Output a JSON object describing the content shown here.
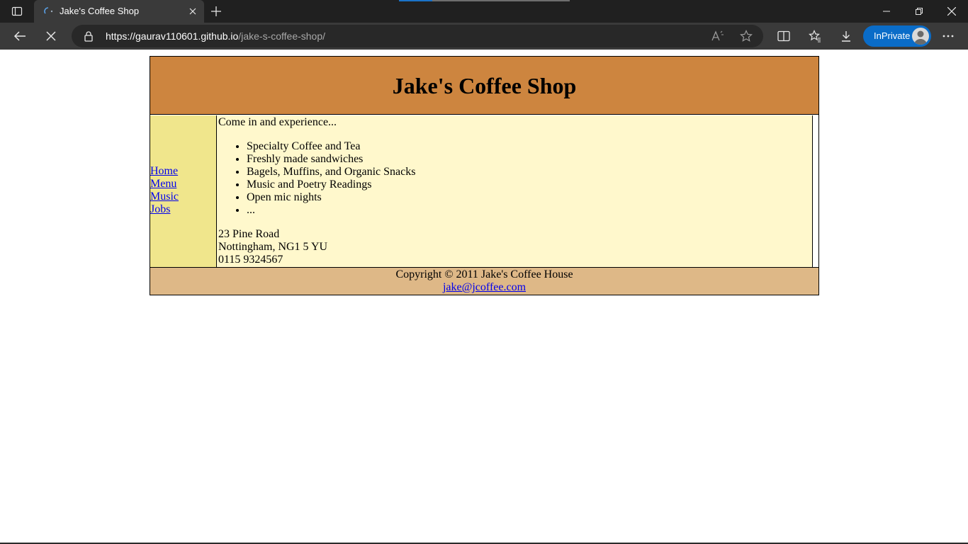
{
  "browser": {
    "tab": {
      "title": "Jake's Coffee Shop"
    },
    "address": {
      "host": "https://gaurav110601.github.io",
      "path": "/jake-s-coffee-shop/"
    },
    "profile_label": "InPrivate",
    "accent_color": "#0a6cc8",
    "icons": [
      "tab-actions-icon",
      "close-icon",
      "plus-icon",
      "minimize-icon",
      "restore-icon",
      "window-close-icon",
      "back-arrow-icon",
      "stop-icon",
      "lock-icon",
      "read-aloud-icon",
      "star-icon",
      "split-screen-icon",
      "favorites-icon",
      "download-icon",
      "avatar-icon",
      "more-icon"
    ]
  },
  "site": {
    "title": "Jake's Coffee Shop",
    "colors": {
      "header": "#cd853f",
      "nav": "#f0e68c",
      "main": "#fff8cc",
      "footer": "#deb887"
    },
    "nav": [
      "Home",
      "Menu",
      "Music",
      "Jobs"
    ],
    "intro": "Come in and experience...",
    "features": [
      "Specialty Coffee and Tea",
      "Freshly made sandwiches",
      "Bagels, Muffins, and Organic Snacks",
      "Music and Poetry Readings",
      "Open mic nights",
      "..."
    ],
    "address": {
      "street": "23 Pine Road",
      "city": "Nottingham, NG1 5 YU",
      "phone": "0115 9324567"
    },
    "footer": {
      "copyright": "Copyright © 2011 Jake's Coffee House",
      "email": "jake@jcoffee.com"
    }
  }
}
